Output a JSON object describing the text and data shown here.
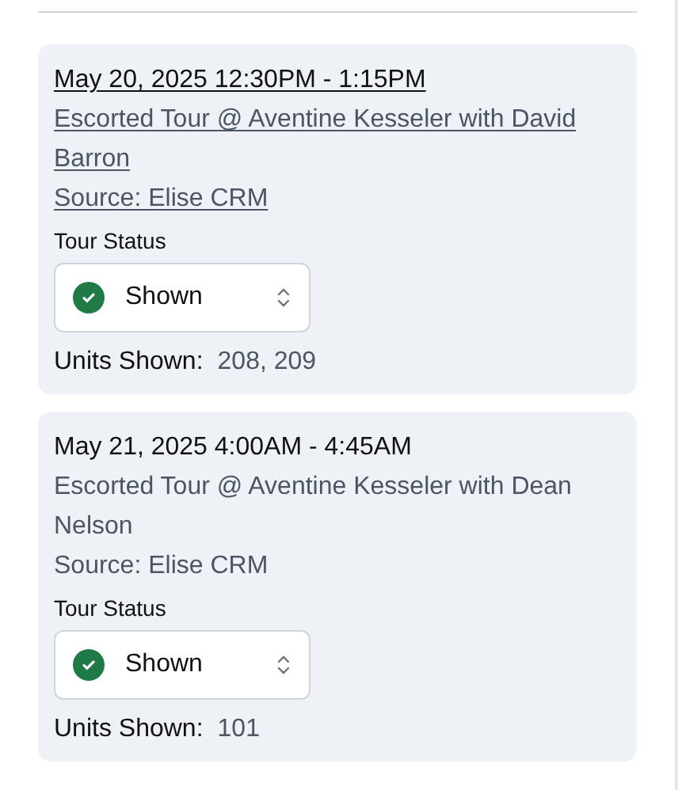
{
  "tours": [
    {
      "datetime": "May 20, 2025 12:30PM - 1:15PM",
      "title": "Escorted Tour @ Aventine Kesseler with David Barron",
      "source": "Source: Elise CRM",
      "hovered": true,
      "status_label": "Tour Status",
      "status": "Shown",
      "units_label": "Units Shown:",
      "units": "208, 209"
    },
    {
      "datetime": "May 21, 2025 4:00AM - 4:45AM",
      "title": "Escorted Tour @ Aventine Kesseler with Dean Nelson",
      "source": "Source: Elise CRM",
      "hovered": false,
      "status_label": "Tour Status",
      "status": "Shown",
      "units_label": "Units Shown:",
      "units": "101"
    }
  ]
}
